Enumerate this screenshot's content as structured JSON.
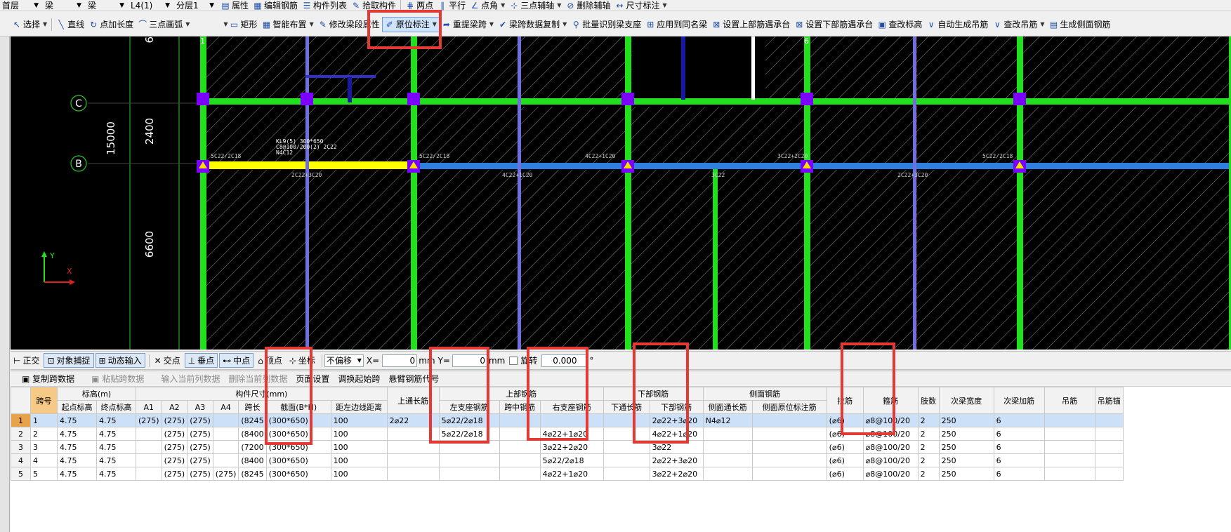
{
  "toolbar1": {
    "floor": "首层",
    "type": "梁",
    "subtype": "梁",
    "element": "L4(1)",
    "layer": "分层1",
    "buttons": [
      "属性",
      "编辑钢筋",
      "构件列表",
      "拾取构件",
      "两点",
      "平行",
      "点角",
      "三点辅轴",
      "删除辅轴",
      "尺寸标注"
    ]
  },
  "toolbar2": {
    "select": "选择",
    "line": "直线",
    "point_length": "点加长度",
    "arc": "三点画弧",
    "rect": "矩形",
    "smart": "智能布置",
    "modify_span": "修改梁段属性",
    "original_annot": "原位标注",
    "reextract": "重提梁跨",
    "copy_span": "梁跨数据复制",
    "batch_support": "批量识别梁支座",
    "apply_same": "应用到同名梁",
    "set_upper": "设置上部筋遇承台",
    "set_lower": "设置下部筋遇承台",
    "check_elev": "查改标高",
    "auto_hanger": "自动生成吊筋",
    "edit_hanger": "查改吊筋",
    "side_rebar": "生成侧面钢筋"
  },
  "canvas": {
    "axes": [
      "C",
      "B"
    ],
    "grid_cols": [
      "1",
      "6"
    ],
    "dims": [
      "15000",
      "2400",
      "6600",
      "6"
    ],
    "beam_label": [
      "KL9(5) 300*650",
      "C8@100/200(2) 2C22",
      "N4C12"
    ],
    "beam_marks": [
      "5C22/2C18",
      "5C22/2C18",
      "4C22+1C20",
      "3C22+2C20",
      "5C22/2C18"
    ],
    "bottom_marks": [
      "2C22+3C20",
      "4C22+1C20",
      "3C22",
      "2C22+3C20"
    ],
    "coord_x": "X",
    "coord_y": "Y"
  },
  "snapbar": {
    "ortho": "正交",
    "snap": "对象捕捉",
    "dyn": "动态输入",
    "intersect": "交点",
    "perp": "垂点",
    "mid": "中点",
    "vertex": "顶点",
    "coord": "坐标",
    "offset": "不偏移",
    "x_label": "X=",
    "x_val": "0",
    "unit_mm": "mm",
    "y_label": "Y=",
    "y_val": "0",
    "rotate": "旋转",
    "rotate_val": "0.000",
    "degree": "°"
  },
  "gridtools": {
    "copy": "复制跨数据",
    "paste": "粘贴跨数据",
    "input_col": "输入当前列数据",
    "delete_col": "删除当前列数据",
    "page_setup": "页面设置",
    "swap_start": "调换起始跨",
    "cantilever": "悬臂钢筋代号"
  },
  "table": {
    "group_headers": {
      "elev": "标高(m)",
      "size": "构件尺寸(mm)",
      "upper": "上部钢筋",
      "lower": "下部钢筋",
      "side": "侧面钢筋"
    },
    "headers": {
      "span": "跨号",
      "start_elev": "起点标高",
      "end_elev": "终点标高",
      "a1": "A1",
      "a2": "A2",
      "a3": "A3",
      "a4": "A4",
      "span_len": "跨长",
      "section": "截面(B*H)",
      "dist": "距左边线距离",
      "top_through": "上通长筋",
      "left_support": "左支座钢筋",
      "mid_span": "跨中钢筋",
      "right_support": "右支座钢筋",
      "bot_through": "下通长筋",
      "bot_rebar": "下部钢筋",
      "side_through": "侧面通长筋",
      "side_orig": "侧面原位标注筋",
      "tie": "拉筋",
      "stirrup": "箍筋",
      "legs": "肢数",
      "sec_width": "次梁宽度",
      "sec_add": "次梁加筋",
      "hanger": "吊筋",
      "hanger_anchor": "吊筋锚"
    },
    "rows": [
      {
        "rn": "1",
        "span": "1",
        "start": "4.75",
        "end": "4.75",
        "a1": "(275)",
        "a2": "(275)",
        "a3": "(275)",
        "a4": "",
        "len": "(8245",
        "section": "(300*650)",
        "dist": "100",
        "top": "2⌀22",
        "left": "5⌀22/2⌀18",
        "mid": "",
        "right": "",
        "bthru": "",
        "bot": "2⌀22+3⌀20",
        "sthru": "N4⌀12",
        "sorig": "",
        "tie": "(⌀6)",
        "stir": "⌀8@100/20",
        "legs": "2",
        "sw": "250",
        "sadd": "6",
        "hang": "",
        "ha": ""
      },
      {
        "rn": "2",
        "span": "2",
        "start": "4.75",
        "end": "4.75",
        "a1": "",
        "a2": "(275)",
        "a3": "(275)",
        "a4": "",
        "len": "(8400",
        "section": "(300*650)",
        "dist": "100",
        "top": "",
        "left": "5⌀22/2⌀18",
        "mid": "",
        "right": "4⌀22+1⌀20",
        "bthru": "",
        "bot": "4⌀22+1⌀20",
        "sthru": "",
        "sorig": "",
        "tie": "(⌀6)",
        "stir": "⌀8@100/20",
        "legs": "2",
        "sw": "250",
        "sadd": "6",
        "hang": "",
        "ha": ""
      },
      {
        "rn": "3",
        "span": "3",
        "start": "4.75",
        "end": "4.75",
        "a1": "",
        "a2": "(275)",
        "a3": "(275)",
        "a4": "",
        "len": "(7200",
        "section": "(300*650)",
        "dist": "100",
        "top": "",
        "left": "",
        "mid": "",
        "right": "3⌀22+2⌀20",
        "bthru": "",
        "bot": "3⌀22",
        "sthru": "",
        "sorig": "",
        "tie": "(⌀6)",
        "stir": "⌀8@100/20",
        "legs": "2",
        "sw": "250",
        "sadd": "6",
        "hang": "",
        "ha": ""
      },
      {
        "rn": "4",
        "span": "4",
        "start": "4.75",
        "end": "4.75",
        "a1": "",
        "a2": "(275)",
        "a3": "(275)",
        "a4": "",
        "len": "(8400",
        "section": "(300*650)",
        "dist": "100",
        "top": "",
        "left": "",
        "mid": "",
        "right": "5⌀22/2⌀18",
        "bthru": "",
        "bot": "2⌀22+3⌀20",
        "sthru": "",
        "sorig": "",
        "tie": "(⌀6)",
        "stir": "⌀8@100/20",
        "legs": "2",
        "sw": "250",
        "sadd": "6",
        "hang": "",
        "ha": ""
      },
      {
        "rn": "5",
        "span": "5",
        "start": "4.75",
        "end": "4.75",
        "a1": "",
        "a2": "(275)",
        "a3": "(275)",
        "a4": "(275)",
        "len": "(8245",
        "section": "(300*650)",
        "dist": "100",
        "top": "",
        "left": "",
        "mid": "",
        "right": "4⌀22+1⌀20",
        "bthru": "",
        "bot": "3⌀22+2⌀20",
        "sthru": "",
        "sorig": "",
        "tie": "(⌀6)",
        "stir": "⌀8@100/20",
        "legs": "2",
        "sw": "250",
        "sadd": "6",
        "hang": "",
        "ha": ""
      }
    ]
  },
  "colors": {
    "canvas_bg": "#000000",
    "beam_green": "#22e01e",
    "beam_blue": "#2f7fe0",
    "beam_selected": "#ffff00",
    "column_purple": "#7b00ff",
    "highlight_red": "#e53935"
  }
}
